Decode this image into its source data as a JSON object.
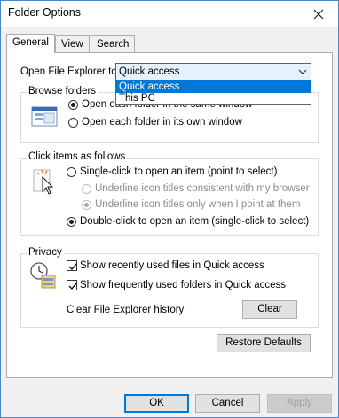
{
  "window": {
    "title": "Folder Options"
  },
  "tabs": [
    {
      "label": "General",
      "active": true
    },
    {
      "label": "View",
      "active": false
    },
    {
      "label": "Search",
      "active": false
    }
  ],
  "open_explorer": {
    "label": "Open File Explorer to:",
    "selected": "Quick access",
    "options": [
      "Quick access",
      "This PC"
    ],
    "highlighted": "Quick access"
  },
  "browse_folders": {
    "title": "Browse folders",
    "option1": "Open each folder in the same window",
    "option1_checked": true,
    "option2": "Open each folder in its own window",
    "option2_checked": false
  },
  "click_items": {
    "title": "Click items as follows",
    "single_click": "Single-click to open an item (point to select)",
    "underline_browser": "Underline icon titles consistent with my browser",
    "underline_point": "Underline icon titles only when I point at them",
    "double_click": "Double-click to open an item (single-click to select)",
    "selected": "double"
  },
  "privacy": {
    "title": "Privacy",
    "recent_files": "Show recently used files in Quick access",
    "frequent_folders": "Show frequently used folders in Quick access",
    "recent_files_checked": true,
    "frequent_folders_checked": true,
    "clear_history_label": "Clear File Explorer history",
    "clear_button": "Clear"
  },
  "restore_defaults": "Restore Defaults",
  "footer": {
    "ok": "OK",
    "cancel": "Cancel",
    "apply": "Apply"
  },
  "colors": {
    "accent": "#0078d7",
    "title_bar": "#ffffff",
    "dialog_bg": "#f0f0f0"
  }
}
